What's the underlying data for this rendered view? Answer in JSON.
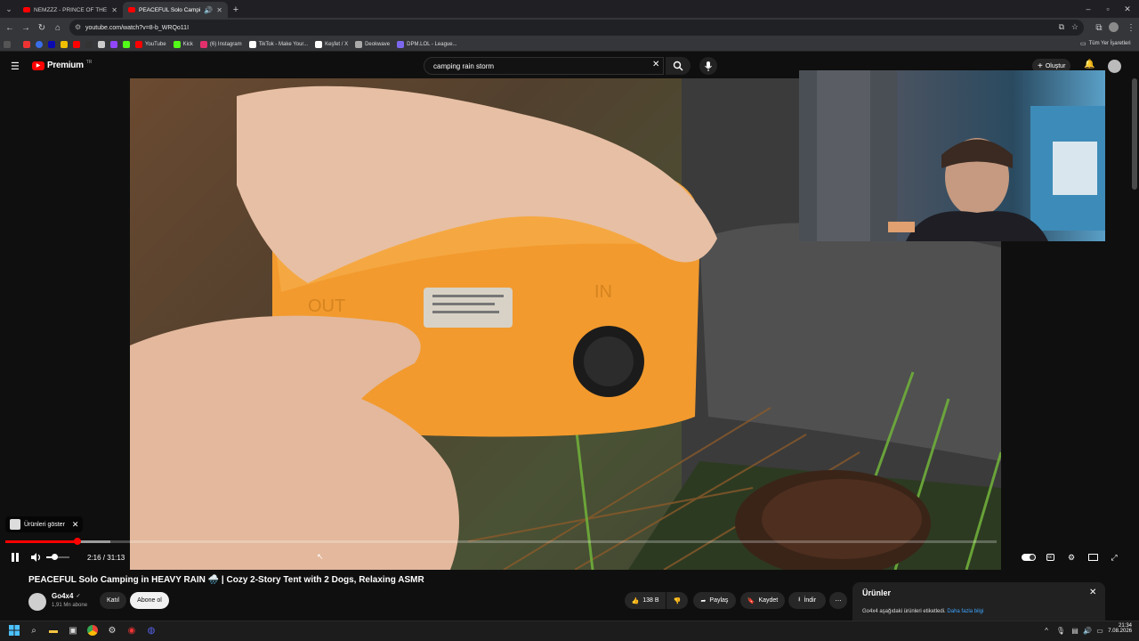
{
  "browser": {
    "tabs": [
      {
        "label": "NEMZZZ - PRINCE OF THE SCE",
        "active": false
      },
      {
        "label": "PEACEFUL Solo Camping in",
        "active": true
      }
    ],
    "url": "youtube.com/watch?v=8-b_WRQo11I",
    "bookmarks": [
      {
        "label": "YouTube",
        "color": "#ff0000"
      },
      {
        "label": "Kick",
        "color": "#53fc18"
      },
      {
        "label": "(6) Instagram",
        "color": "#e1306c"
      },
      {
        "label": "TikTok - Make Your...",
        "color": "#ffffff"
      },
      {
        "label": "Keşfet / X",
        "color": "#ffffff"
      },
      {
        "label": "Deokwave",
        "color": "#aaaaaa"
      },
      {
        "label": "DPM.LOL - League...",
        "color": "#7b68ee"
      }
    ],
    "all_bookmarks_label": "Tüm Yer İşaretleri"
  },
  "youtube": {
    "logo_label": "Premium",
    "logo_badge": "TR",
    "search_value": "camping rain storm",
    "create_label": "Oluştur"
  },
  "player": {
    "products_label": "Ürünleri göster",
    "time_label": "2:16 / 31:13",
    "progress_fraction": 0.0728,
    "buffer_fraction": 0.106,
    "volume_fraction": 0.35
  },
  "video_info": {
    "title": "PEACEFUL Solo Camping in HEAVY RAIN 🌧️ | Cozy 2-Story Tent with 2 Dogs, Relaxing ASMR",
    "channel_name": "Go4x4",
    "subscribers": "1,91 Mn abone",
    "join_label": "Katıl",
    "subscribe_label": "Abone ol",
    "like_count": "138 B",
    "share_label": "Paylaş",
    "save_label": "Kaydet",
    "download_label": "İndir"
  },
  "products_panel": {
    "title": "Ürünler",
    "description": "Go4x4 aşağıdaki ürünleri etiketledi.",
    "link_label": "Daha fazla bilgi"
  },
  "taskbar": {
    "time": "21:34",
    "date": "7.08.2026"
  },
  "video_frame_text": {
    "out_label": "OUT",
    "in_label": "IN"
  }
}
